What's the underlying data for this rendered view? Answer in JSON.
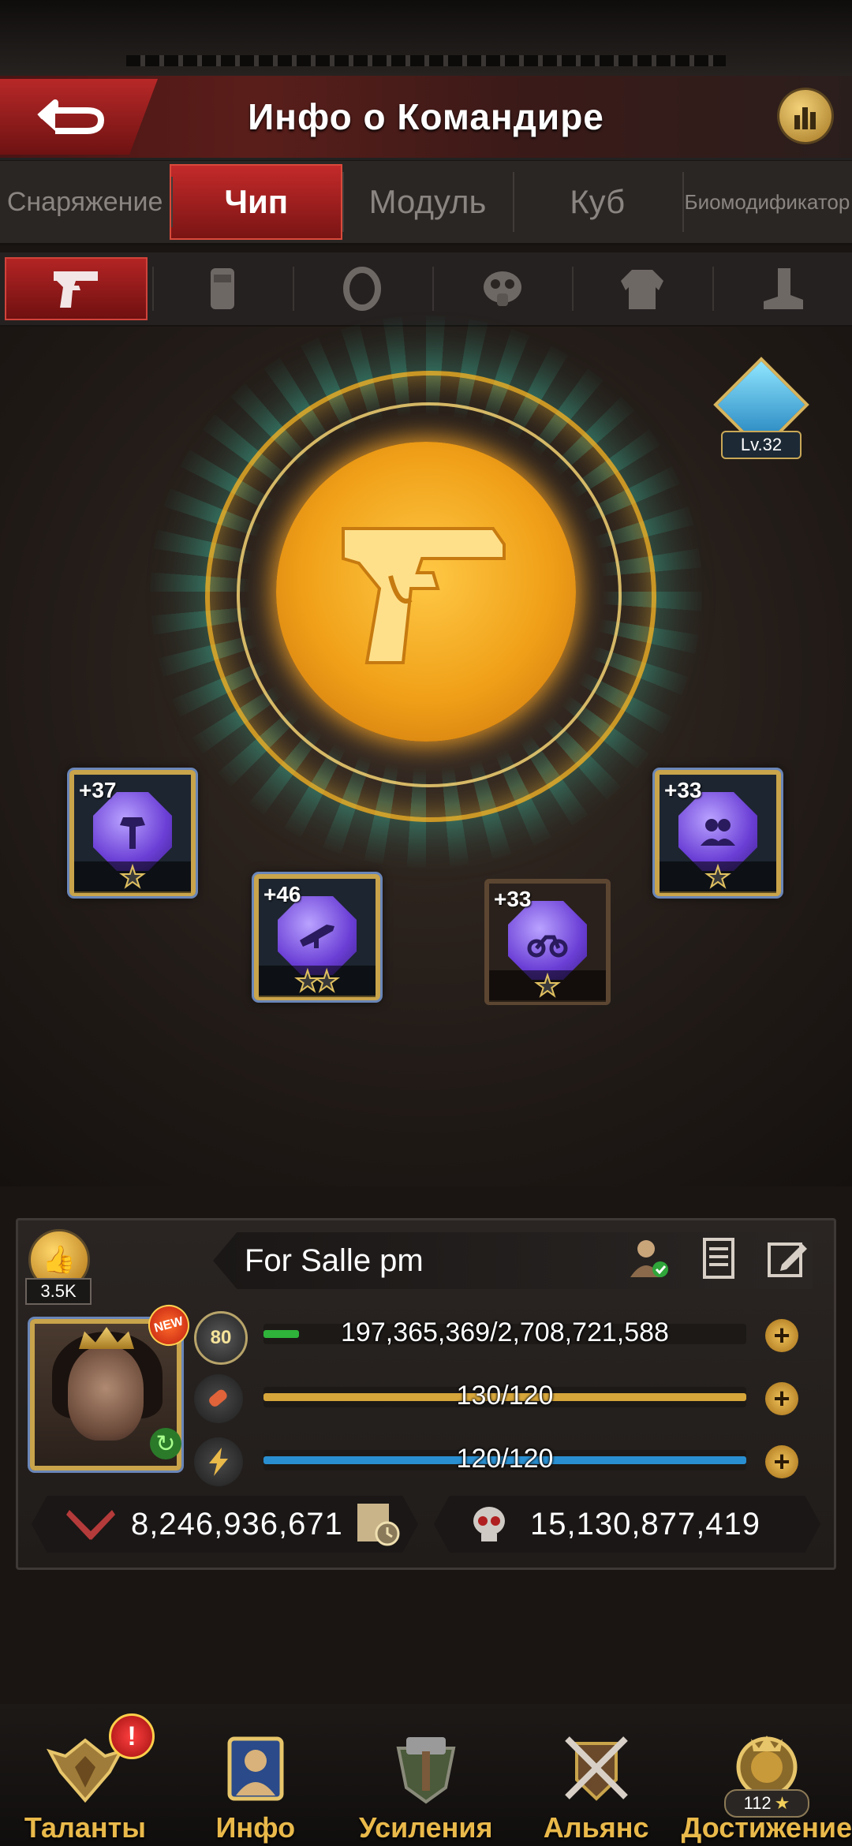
{
  "header": {
    "title": "Инфо о Командире"
  },
  "tabs": [
    {
      "label": "Снаряжение",
      "active": false
    },
    {
      "label": "Чип",
      "active": true
    },
    {
      "label": "Модуль",
      "active": false
    },
    {
      "label": "Куб",
      "active": false
    },
    {
      "label": "Биомодификатор",
      "active": false
    }
  ],
  "gear_slots": [
    {
      "icon": "pistol-icon",
      "active": true
    },
    {
      "icon": "vest-icon",
      "active": false
    },
    {
      "icon": "ring-icon",
      "active": false
    },
    {
      "icon": "gas-mask-icon",
      "active": false
    },
    {
      "icon": "jacket-icon",
      "active": false
    },
    {
      "icon": "boot-icon",
      "active": false
    }
  ],
  "core": {
    "icon": "pistol-icon",
    "level_label": "Lv.32"
  },
  "chips": [
    {
      "plus": "+37",
      "icon": "hammer-icon",
      "stars": 1
    },
    {
      "plus": "+46",
      "icon": "rifle-icon",
      "stars": 2
    },
    {
      "plus": "+33",
      "icon": "motorcycle-icon",
      "stars": 1
    },
    {
      "plus": "+33",
      "icon": "group-icon",
      "stars": 1
    }
  ],
  "commander": {
    "name": "For Salle pm",
    "likes": "3.5K",
    "level": "80",
    "new_badge": "NEW",
    "exp": {
      "text": "197,365,369/2,708,721,588",
      "fill": 0.073
    },
    "stamina": {
      "text": "130/120",
      "fill": 1.0
    },
    "energy": {
      "text": "120/120",
      "fill": 1.0
    },
    "power": "8,246,936,671",
    "kills": "15,130,877,419"
  },
  "nav": [
    {
      "label": "Таланты",
      "icon": "wings-emblem-icon"
    },
    {
      "label": "Инфо",
      "icon": "commander-portrait-icon"
    },
    {
      "label": "Усиления",
      "icon": "hammer-shield-icon"
    },
    {
      "label": "Альянс",
      "icon": "crossed-swords-icon"
    },
    {
      "label": "Достижение",
      "icon": "lion-crest-icon",
      "count": "112"
    }
  ],
  "alert": "!",
  "colors": {
    "accent_red": "#c42a2a",
    "gold": "#e9b94a",
    "exp_green": "#2fb33a",
    "stamina_gold": "#d7a63a",
    "energy_blue": "#2a8fd0"
  }
}
